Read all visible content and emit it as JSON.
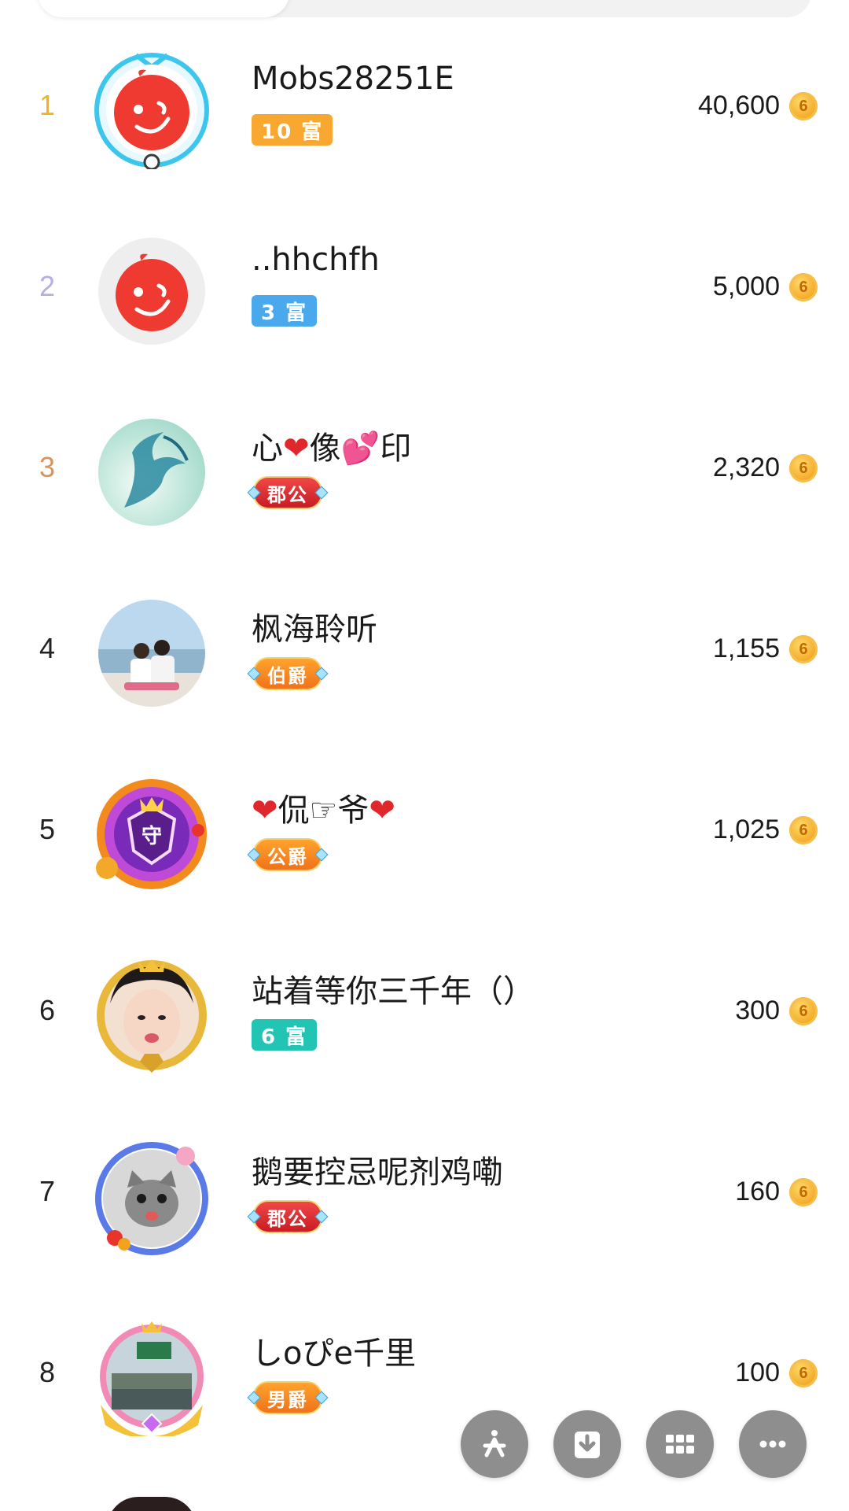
{
  "ranking": {
    "rows": [
      {
        "rank": "1",
        "rank_color": "#f2b21c",
        "name": "Mobs28251E",
        "badge": "10 富",
        "amount": "40,600",
        "avatar": "app-logo-framed"
      },
      {
        "rank": "2",
        "rank_color": "#b4b0e2",
        "name": "..hhchfh",
        "badge": "3 富",
        "amount": "5,000",
        "avatar": "app-logo"
      },
      {
        "rank": "3",
        "rank_color": "#d8945a",
        "name_parts": [
          "心",
          "❤",
          "像",
          "💕",
          "印"
        ],
        "badge": "郡公",
        "amount": "2,320",
        "avatar": "dragon-photo"
      },
      {
        "rank": "4",
        "rank_color": "#222222",
        "name": "枫海聆听",
        "badge": "伯爵",
        "amount": "1,155",
        "avatar": "couple-beach-photo"
      },
      {
        "rank": "5",
        "rank_color": "#222222",
        "name_parts": [
          "❤",
          "侃☞爷",
          "❤"
        ],
        "badge": "公爵",
        "amount": "1,025",
        "avatar": "guard-frame"
      },
      {
        "rank": "6",
        "rank_color": "#222222",
        "name": "站着等你三千年（）",
        "badge": "6 富",
        "amount": "300",
        "avatar": "girl-photo-gold-frame"
      },
      {
        "rank": "7",
        "rank_color": "#222222",
        "name": "鹅要控忌呢剂鸡嘞",
        "badge": "郡公",
        "amount": "160",
        "avatar": "cat-photo-flower-frame"
      },
      {
        "rank": "8",
        "rank_color": "#222222",
        "name": "しoぴe千里",
        "badge": "男爵",
        "amount": "100",
        "avatar": "road-photo-pink-frame"
      }
    ]
  },
  "coin_icon": "coin-icon",
  "fab_buttons": [
    "pinwheel-icon",
    "download-icon",
    "grid-icon",
    "more-icon"
  ],
  "colors": {
    "fortune_orange": "#f8a830",
    "fortune_blue": "#4aa8ec",
    "fortune_teal": "#22c4b4",
    "noble_red": "#d8262e",
    "noble_orange": "#f58a22",
    "fab_gray": "#8e8e8e"
  }
}
